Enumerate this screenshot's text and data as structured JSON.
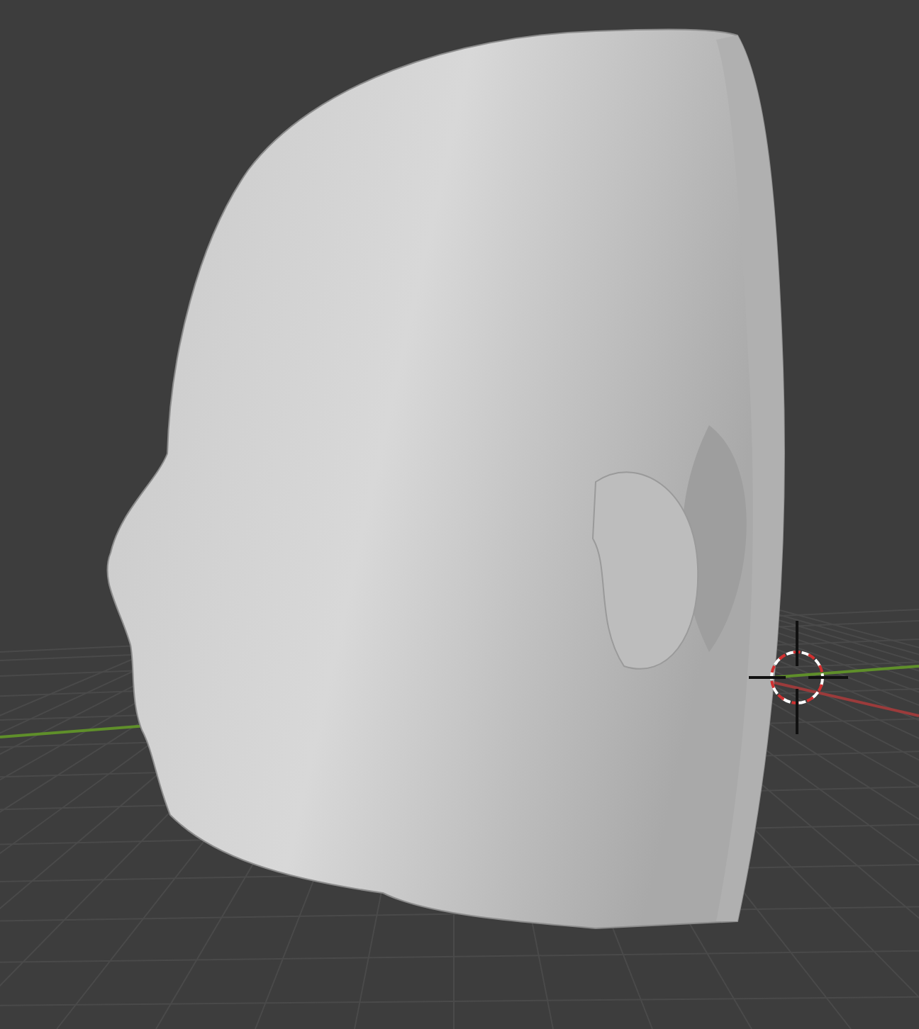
{
  "viewport": {
    "axes": [
      {
        "kind": "x",
        "color": "#9b3b3b"
      },
      {
        "kind": "y",
        "color": "#5f8f2a"
      }
    ]
  }
}
